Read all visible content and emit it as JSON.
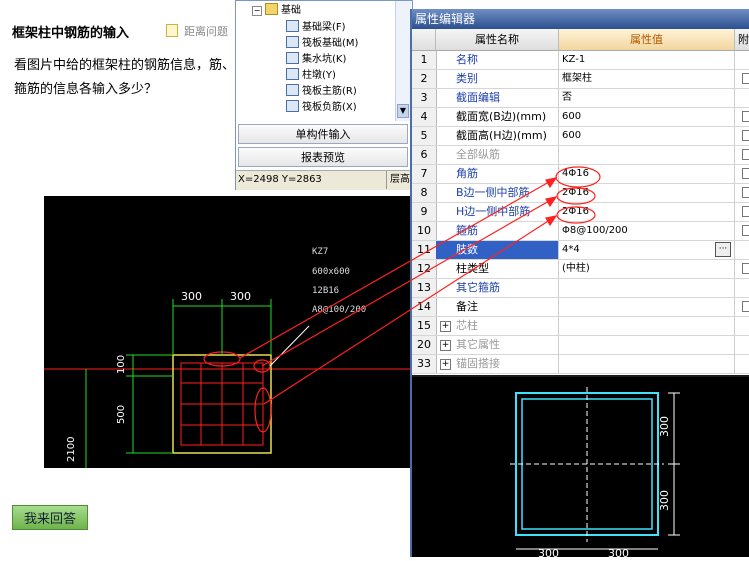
{
  "question": {
    "title": "框架柱中钢筋的输入",
    "deadline": "距离问题",
    "body": "看图片中给的框架柱的钢筋信息，筋、箍筋的信息各输入多少？",
    "answer_button": "我来回答"
  },
  "drawing": {
    "label": "KZ7",
    "size": "600x600",
    "rebar": "12B16",
    "stirrup": "A8@100/200",
    "dim_left": "300",
    "dim_right": "300",
    "dim_100": "100",
    "dim_500": "500",
    "dim_2100": "2100"
  },
  "tree": {
    "parent": "基础",
    "items": [
      "基础梁(F)",
      "筏板基础(M)",
      "集水坑(K)",
      "柱墩(Y)",
      "筏板主筋(R)",
      "筏板负筋(X)"
    ],
    "single_input": "单构件输入",
    "report_preview": "报表预览",
    "coords": "X=2498 Y=2863",
    "status_tail": "层高"
  },
  "prop_editor": {
    "title": "属性编辑器",
    "col_name": "属性名称",
    "col_value": "属性值",
    "col_extra": "附加",
    "rows": [
      {
        "num": "1",
        "name": "名称",
        "value": "KZ-1",
        "style": "blue",
        "check": false
      },
      {
        "num": "2",
        "name": "类别",
        "value": "框架柱",
        "style": "blue",
        "check": true
      },
      {
        "num": "3",
        "name": "截面编辑",
        "value": "否",
        "style": "blue",
        "check": false
      },
      {
        "num": "4",
        "name": "截面宽(B边)(mm)",
        "value": "600",
        "style": "black",
        "check": true
      },
      {
        "num": "5",
        "name": "截面高(H边)(mm)",
        "value": "600",
        "style": "black",
        "check": true
      },
      {
        "num": "6",
        "name": "全部纵筋",
        "value": "",
        "style": "gray",
        "check": true
      },
      {
        "num": "7",
        "name": "角筋",
        "value": "4Φ16",
        "style": "blue",
        "check": true
      },
      {
        "num": "8",
        "name": "B边一侧中部筋",
        "value": "2Φ16",
        "style": "blue",
        "check": true
      },
      {
        "num": "9",
        "name": "H边一侧中部筋",
        "value": "2Φ16",
        "style": "blue",
        "check": true
      },
      {
        "num": "10",
        "name": "箍筋",
        "value": "Φ8@100/200",
        "style": "blue",
        "check": true
      },
      {
        "num": "11",
        "name": "肢数",
        "value": "4*4",
        "style": "selected",
        "check": false
      },
      {
        "num": "12",
        "name": "柱类型",
        "value": "(中柱)",
        "style": "black",
        "check": true
      },
      {
        "num": "13",
        "name": "其它箍筋",
        "value": "",
        "style": "blue",
        "check": false
      },
      {
        "num": "14",
        "name": "备注",
        "value": "",
        "style": "black",
        "check": true
      },
      {
        "num": "15",
        "name": "芯柱",
        "value": "",
        "style": "group",
        "check": false
      },
      {
        "num": "20",
        "name": "其它属性",
        "value": "",
        "style": "group",
        "check": false
      },
      {
        "num": "33",
        "name": "锚固搭接",
        "value": "",
        "style": "group",
        "check": false
      }
    ]
  },
  "preview": {
    "dim_v1": "300",
    "dim_v2": "300",
    "dim_h1": "300",
    "dim_h2": "300"
  },
  "colors": {
    "cad_red": "#ff2020",
    "cad_green": "#22dd22",
    "cad_cyan": "#40e0ff",
    "selected_row": "#3161c5"
  }
}
